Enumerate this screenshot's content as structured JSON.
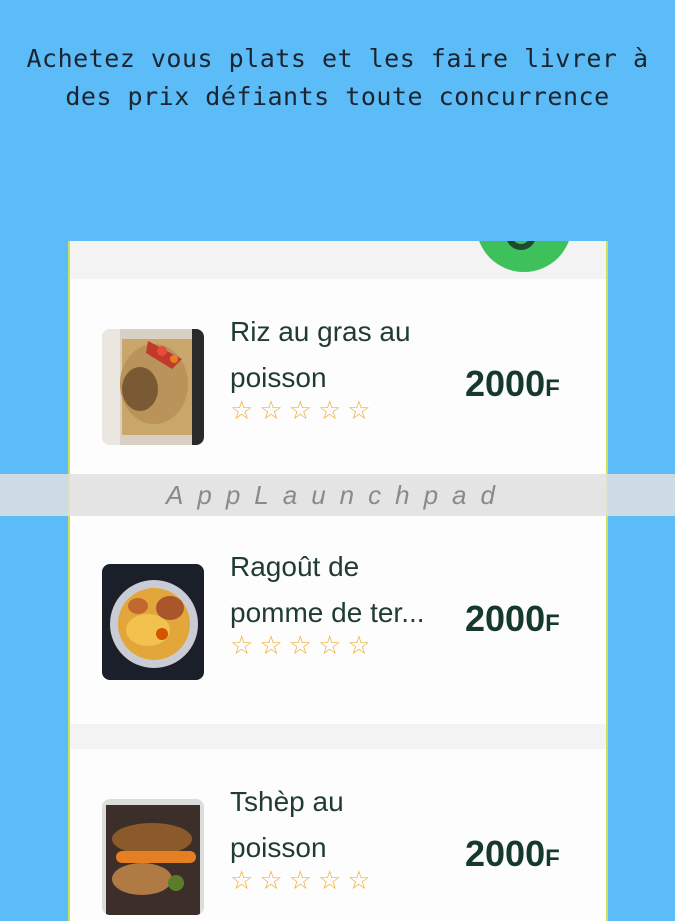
{
  "header": {
    "line1": "Achetez vous plats et les faire livrer à",
    "line2": "des prix défiants toute concurrence"
  },
  "fab": {
    "icon": "cart-icon",
    "color": "#3ec15a"
  },
  "watermark": "AppLaunchpad",
  "rating_icon": "star-outline-icon",
  "dishes": [
    {
      "title_line1": "Riz au gras au",
      "title_line2": "poisson",
      "rating": 0,
      "price": "2000",
      "currency": "F"
    },
    {
      "title_line1": "Ragoût de",
      "title_line2": "pomme de ter...",
      "rating": 0,
      "price": "2000",
      "currency": "F"
    },
    {
      "title_line1": "Tshèp au",
      "title_line2": "poisson",
      "rating": 0,
      "price": "2000",
      "currency": "F"
    }
  ],
  "colors": {
    "background": "#5bbcf7",
    "price": "#16392e",
    "star": "#f1b13e"
  }
}
